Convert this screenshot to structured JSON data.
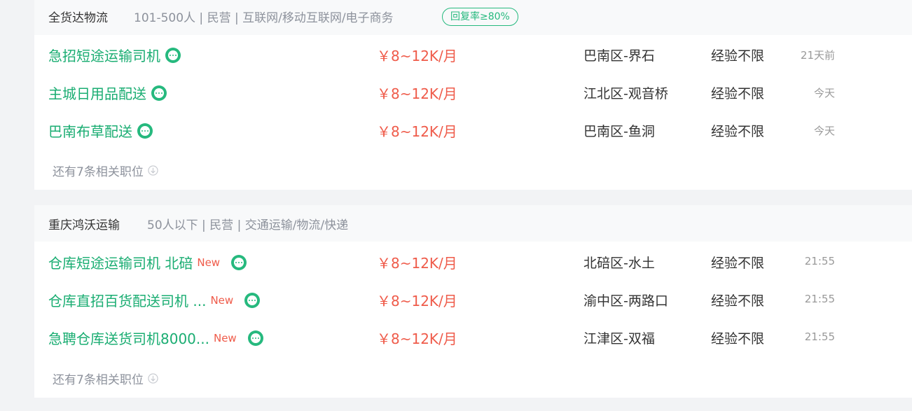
{
  "companies": [
    {
      "name": "全货达物流",
      "info": "101-500人 | 民营 | 互联网/移动互联网/电子商务",
      "badge": "回复率≥80%",
      "jobs": [
        {
          "title": "急招短途运输司机",
          "salary": "￥8~12K/月",
          "location": "巴南区-界石",
          "experience": "经验不限",
          "time": "21天前"
        },
        {
          "title": "主城日用品配送",
          "salary": "￥8~12K/月",
          "location": "江北区-观音桥",
          "experience": "经验不限",
          "time": "今天"
        },
        {
          "title": "巴南布草配送",
          "salary": "￥8~12K/月",
          "location": "巴南区-鱼洞",
          "experience": "经验不限",
          "time": "今天"
        }
      ],
      "more_label": "还有7条相关职位"
    },
    {
      "name": "重庆鸿沃运输",
      "info": "50人以下 | 民营 | 交通运输/物流/快递",
      "jobs": [
        {
          "title": "仓库短途运输司机 北碚",
          "tag": "New",
          "salary": "￥8~12K/月",
          "location": "北碚区-水土",
          "experience": "经验不限",
          "time": "21:55"
        },
        {
          "title": "仓库直招百货配送司机 ...",
          "tag": "New",
          "salary": "￥8~12K/月",
          "location": "渝中区-两路口",
          "experience": "经验不限",
          "time": "21:55"
        },
        {
          "title": "急聘仓库送货司机8000...",
          "tag": "New",
          "salary": "￥8~12K/月",
          "location": "江津区-双福",
          "experience": "经验不限",
          "time": "21:55"
        }
      ],
      "more_label": "还有7条相关职位"
    }
  ],
  "colors": {
    "accent_green": "#26b97e",
    "salary_red": "#ef5b4a",
    "muted_gray": "#8d929c"
  },
  "icons": {
    "chat": "chat-bubble-icon",
    "expand": "circle-arrow-down-icon"
  }
}
